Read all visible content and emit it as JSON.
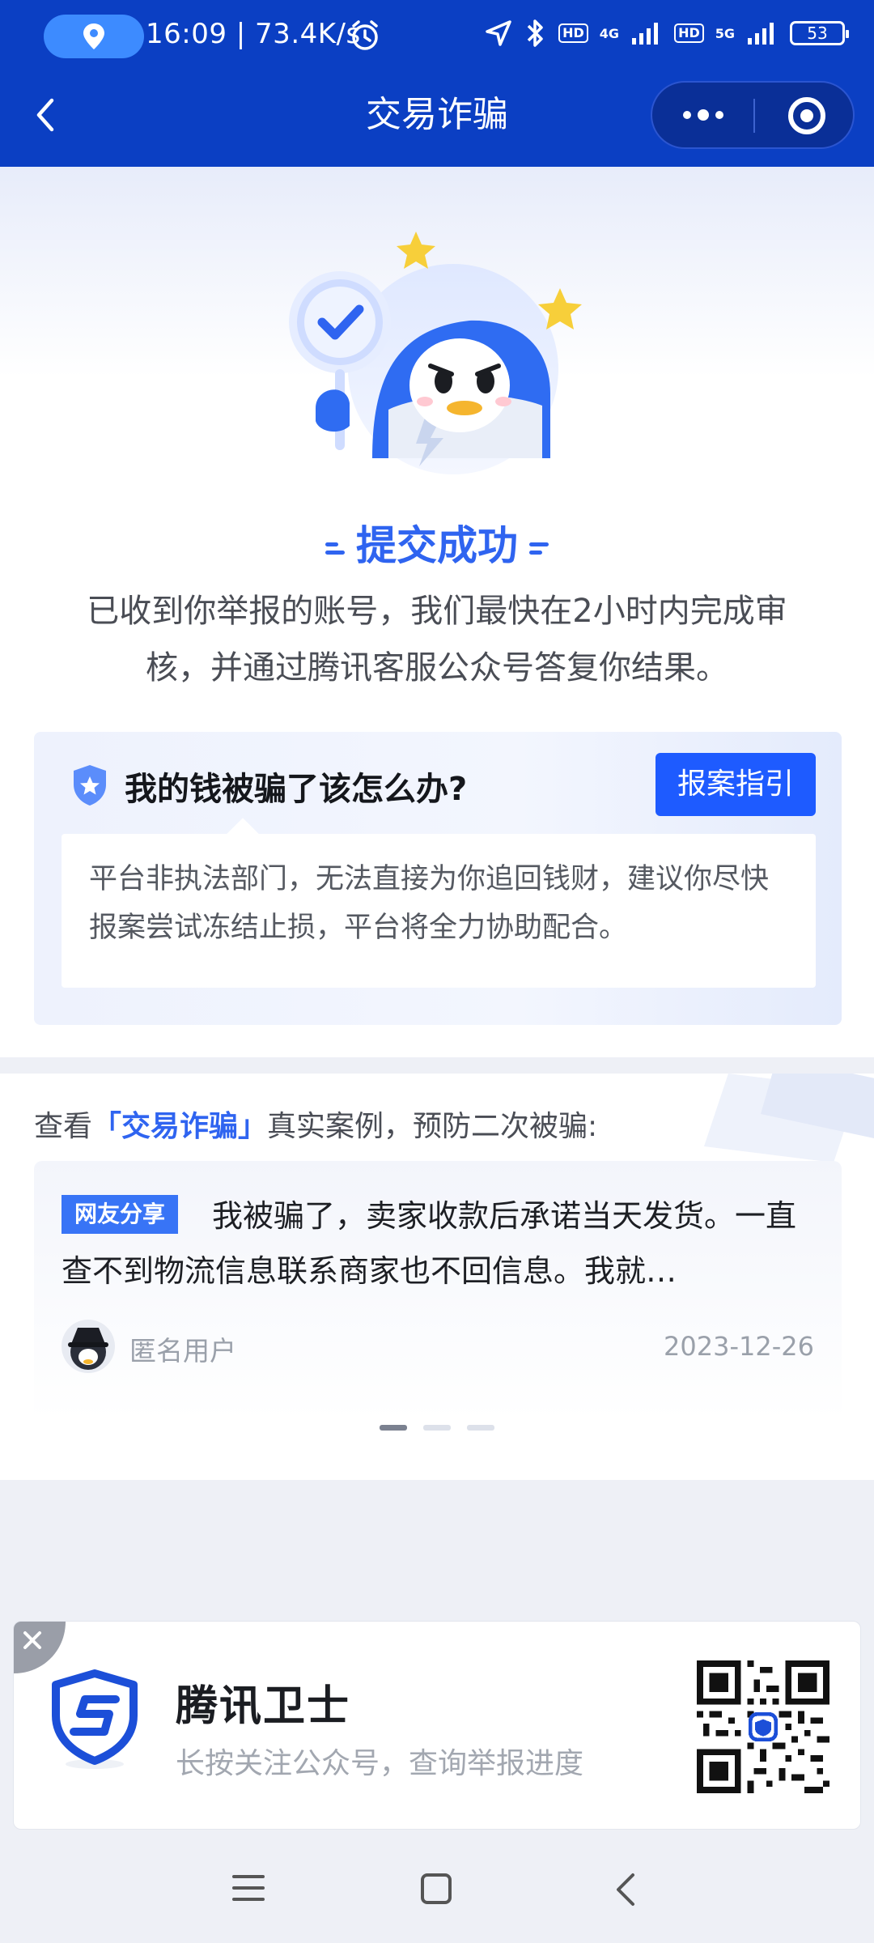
{
  "status": {
    "time_speed": "16:09 | 73.4K/s",
    "network_4g": "4G",
    "network_5g": "5G",
    "hd1": "HD",
    "hd2": "HD",
    "battery": "53"
  },
  "header": {
    "title": "交易诈骗",
    "back_icon": "chevron-left-icon",
    "more_icon": "more-dots-icon",
    "close_icon": "target-circle-icon"
  },
  "success": {
    "title": "提交成功",
    "description": "已收到你举报的账号，我们最快在2小时内完成审核，并通过腾讯客服公众号答复你结果。"
  },
  "help": {
    "question": "我的钱被骗了该怎么办?",
    "button_label": "报案指引",
    "note": "平台非执法部门，无法直接为你追回钱财，建议你尽快报案尝试冻结止损，平台将全力协助配合。"
  },
  "cases": {
    "head_prefix": "查看",
    "head_highlight": "「交易诈骗」",
    "head_suffix": "真实案例，预防二次被骗:",
    "items": [
      {
        "tag": "网友分享",
        "text": "我被骗了，卖家收款后承诺当天发货。一直查不到物流信息联系商家也不回信息。我就…",
        "user": "匿名用户",
        "date": "2023-12-26"
      }
    ],
    "page_count": 3,
    "active_page": 1
  },
  "banner": {
    "brand": "腾讯卫士",
    "subtitle": "长按关注公众号，查询举报进度"
  },
  "colors": {
    "brand_blue": "#0b3fc3",
    "accent": "#2f64f0",
    "button": "#1e5bff"
  }
}
